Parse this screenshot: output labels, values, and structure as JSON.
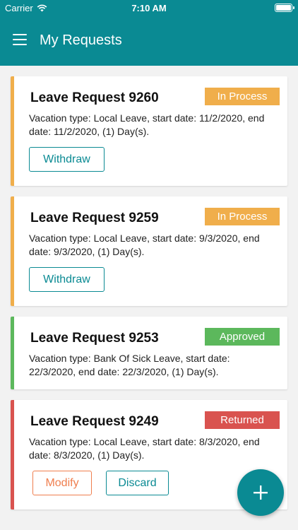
{
  "status_bar": {
    "carrier": "Carrier",
    "time": "7:10 AM"
  },
  "header": {
    "title": "My Requests"
  },
  "colors": {
    "primary": "#0a8a93",
    "in_process": "#f0ae4b",
    "approved": "#5cb85c",
    "returned": "#d9534f",
    "modify": "#ef7e4e"
  },
  "requests": [
    {
      "title": "Leave Request 9260",
      "status": "In Process",
      "description": "Vacation type: Local Leave, start date: 11/2/2020, end date: 11/2/2020, (1) Day(s).",
      "actions": [
        "Withdraw"
      ]
    },
    {
      "title": "Leave Request 9259",
      "status": "In Process",
      "description": "Vacation type: Local Leave, start date: 9/3/2020, end date: 9/3/2020, (1) Day(s).",
      "actions": [
        "Withdraw"
      ]
    },
    {
      "title": "Leave Request 9253",
      "status": "Approved",
      "description": "Vacation type: Bank Of Sick Leave, start date: 22/3/2020, end date: 22/3/2020, (1) Day(s).",
      "actions": []
    },
    {
      "title": "Leave Request 9249",
      "status": "Returned",
      "description": "Vacation type: Local Leave, start date: 8/3/2020, end date: 8/3/2020, (1) Day(s).",
      "actions": [
        "Modify",
        "Discard"
      ]
    }
  ],
  "fab": {
    "icon": "plus-icon"
  }
}
